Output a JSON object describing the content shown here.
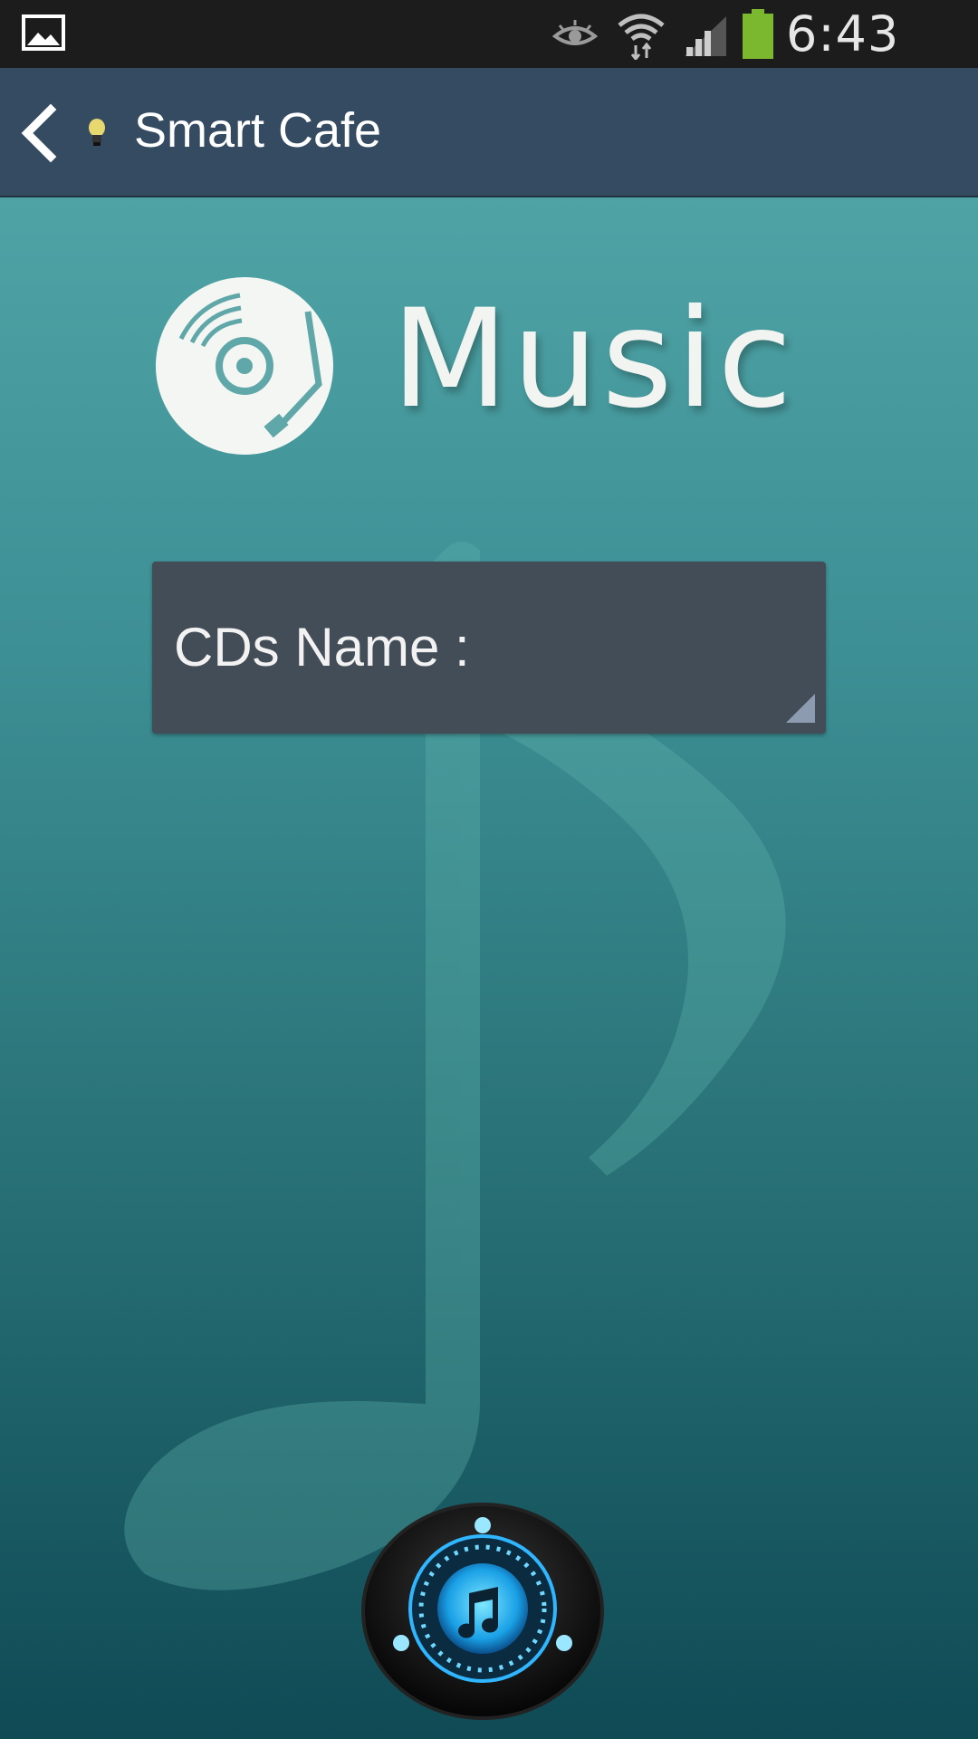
{
  "status_bar": {
    "time": "6:43 PM",
    "icons": [
      "gallery-icon",
      "eye-icon",
      "wifi-icon",
      "signal-icon",
      "battery-icon"
    ],
    "battery_color": "#7cb82f"
  },
  "action_bar": {
    "title": "Smart Cafe",
    "background": "#344b62"
  },
  "main": {
    "logo_text": "Music",
    "cds_spinner": {
      "label": "CDs Name :"
    },
    "play_button_icon": "music-note-icon"
  }
}
